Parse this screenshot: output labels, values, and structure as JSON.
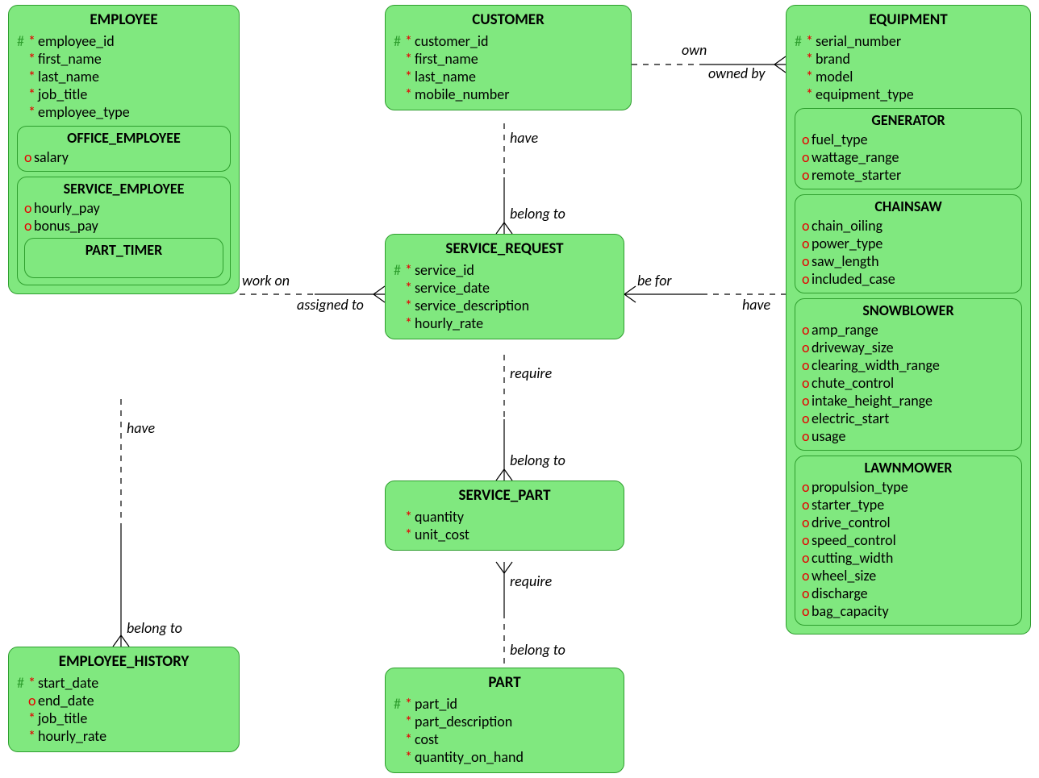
{
  "diagram_type": "Entity-Relationship Diagram (Barker notation)",
  "entities": {
    "employee": {
      "title": "EMPLOYEE",
      "attrs": [
        {
          "hash": true,
          "mark": "*",
          "name": "employee_id"
        },
        {
          "hash": false,
          "mark": "*",
          "name": "first_name"
        },
        {
          "hash": false,
          "mark": "*",
          "name": "last_name"
        },
        {
          "hash": false,
          "mark": "*",
          "name": "job_title"
        },
        {
          "hash": false,
          "mark": "*",
          "name": "employee_type"
        }
      ],
      "subtypes": {
        "office_employee": {
          "title": "OFFICE_EMPLOYEE",
          "attrs": [
            {
              "mark": "o",
              "name": "salary"
            }
          ]
        },
        "service_employee": {
          "title": "SERVICE_EMPLOYEE",
          "attrs": [
            {
              "mark": "o",
              "name": "hourly_pay"
            },
            {
              "mark": "o",
              "name": "bonus_pay"
            }
          ],
          "subtypes": {
            "part_timer": {
              "title": "PART_TIMER",
              "attrs": []
            }
          }
        }
      }
    },
    "customer": {
      "title": "CUSTOMER",
      "attrs": [
        {
          "hash": true,
          "mark": "*",
          "name": "customer_id"
        },
        {
          "hash": false,
          "mark": "*",
          "name": "first_name"
        },
        {
          "hash": false,
          "mark": "*",
          "name": "last_name"
        },
        {
          "hash": false,
          "mark": "*",
          "name": "mobile_number"
        }
      ]
    },
    "equipment": {
      "title": "EQUIPMENT",
      "attrs": [
        {
          "hash": true,
          "mark": "*",
          "name": "serial_number"
        },
        {
          "hash": false,
          "mark": "*",
          "name": "brand"
        },
        {
          "hash": false,
          "mark": "*",
          "name": "model"
        },
        {
          "hash": false,
          "mark": "*",
          "name": "equipment_type"
        }
      ],
      "subtypes": {
        "generator": {
          "title": "GENERATOR",
          "attrs": [
            {
              "mark": "o",
              "name": "fuel_type"
            },
            {
              "mark": "o",
              "name": "wattage_range"
            },
            {
              "mark": "o",
              "name": "remote_starter"
            }
          ]
        },
        "chainsaw": {
          "title": "CHAINSAW",
          "attrs": [
            {
              "mark": "o",
              "name": "chain_oiling"
            },
            {
              "mark": "o",
              "name": "power_type"
            },
            {
              "mark": "o",
              "name": "saw_length"
            },
            {
              "mark": "o",
              "name": "included_case"
            }
          ]
        },
        "snowblower": {
          "title": "SNOWBLOWER",
          "attrs": [
            {
              "mark": "o",
              "name": "amp_range"
            },
            {
              "mark": "o",
              "name": "driveway_size"
            },
            {
              "mark": "o",
              "name": "clearing_width_range"
            },
            {
              "mark": "o",
              "name": "chute_control"
            },
            {
              "mark": "o",
              "name": "intake_height_range"
            },
            {
              "mark": "o",
              "name": "electric_start"
            },
            {
              "mark": "o",
              "name": "usage"
            }
          ]
        },
        "lawnmower": {
          "title": "LAWNMOWER",
          "attrs": [
            {
              "mark": "o",
              "name": "propulsion_type"
            },
            {
              "mark": "o",
              "name": "starter_type"
            },
            {
              "mark": "o",
              "name": "drive_control"
            },
            {
              "mark": "o",
              "name": "speed_control"
            },
            {
              "mark": "o",
              "name": "cutting_width"
            },
            {
              "mark": "o",
              "name": "wheel_size"
            },
            {
              "mark": "o",
              "name": "discharge"
            },
            {
              "mark": "o",
              "name": "bag_capacity"
            }
          ]
        }
      }
    },
    "service_request": {
      "title": "SERVICE_REQUEST",
      "attrs": [
        {
          "hash": true,
          "mark": "*",
          "name": "service_id"
        },
        {
          "hash": false,
          "mark": "*",
          "name": "service_date"
        },
        {
          "hash": false,
          "mark": "*",
          "name": "service_description"
        },
        {
          "hash": false,
          "mark": "*",
          "name": "hourly_rate"
        }
      ]
    },
    "service_part": {
      "title": "SERVICE_PART",
      "attrs": [
        {
          "hash": false,
          "mark": "*",
          "name": "quantity"
        },
        {
          "hash": false,
          "mark": "*",
          "name": "unit_cost"
        }
      ]
    },
    "part": {
      "title": "PART",
      "attrs": [
        {
          "hash": true,
          "mark": "*",
          "name": "part_id"
        },
        {
          "hash": false,
          "mark": "*",
          "name": "part_description"
        },
        {
          "hash": false,
          "mark": "*",
          "name": "cost"
        },
        {
          "hash": false,
          "mark": "*",
          "name": "quantity_on_hand"
        }
      ]
    },
    "employee_history": {
      "title": "EMPLOYEE_HISTORY",
      "attrs": [
        {
          "hash": true,
          "mark": "*",
          "name": "start_date"
        },
        {
          "hash": false,
          "mark": "o",
          "name": "end_date"
        },
        {
          "hash": false,
          "mark": "*",
          "name": "job_title"
        },
        {
          "hash": false,
          "mark": "*",
          "name": "hourly_rate"
        }
      ]
    }
  },
  "relationships": {
    "customer_equipment": {
      "a": "CUSTOMER",
      "b": "EQUIPMENT",
      "a_label": "own",
      "b_label": "owned by"
    },
    "customer_service": {
      "a": "CUSTOMER",
      "b": "SERVICE_REQUEST",
      "a_label": "have",
      "b_label": "belong to"
    },
    "employee_service": {
      "a": "EMPLOYEE",
      "b": "SERVICE_REQUEST",
      "a_label": "work on",
      "b_label": "assigned to"
    },
    "service_equipment": {
      "a": "SERVICE_REQUEST",
      "b": "EQUIPMENT",
      "a_label": "be for",
      "b_label": "have"
    },
    "employee_history": {
      "a": "EMPLOYEE",
      "b": "EMPLOYEE_HISTORY",
      "a_label": "have",
      "b_label": "belong to"
    },
    "service_part": {
      "a": "SERVICE_REQUEST",
      "b": "SERVICE_PART",
      "a_label": "require",
      "b_label": "belong to"
    },
    "part_service_part": {
      "a": "SERVICE_PART",
      "b": "PART",
      "a_label": "require",
      "b_label": "belong to"
    }
  }
}
